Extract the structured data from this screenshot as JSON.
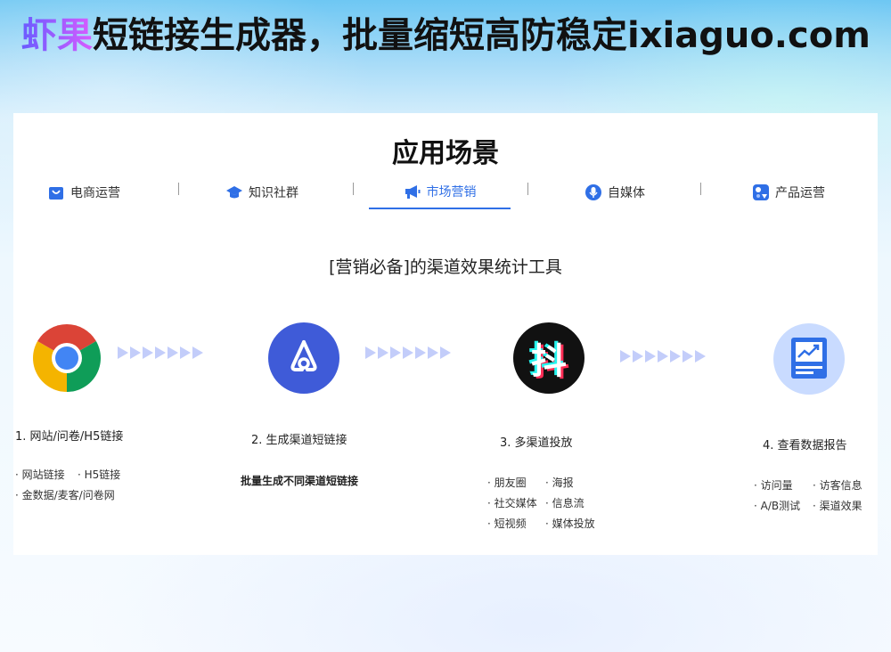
{
  "headline": {
    "brand": "虾果",
    "rest": "短链接生成器，批量缩短高防稳定ixiaguo.com"
  },
  "section": {
    "title": "应用场景"
  },
  "tabs": [
    {
      "label": "电商运营",
      "icon": "shopping-bag-icon"
    },
    {
      "label": "知识社群",
      "icon": "graduation-cap-icon"
    },
    {
      "label": "市场营销",
      "icon": "megaphone-icon",
      "active": true
    },
    {
      "label": "自媒体",
      "icon": "microphone-icon"
    },
    {
      "label": "产品运营",
      "icon": "product-cube-icon"
    }
  ],
  "subtitle": "[营销必备]的渠道效果统计工具",
  "steps": [
    {
      "label": "1. 网站/问卷/H5链接",
      "icon": "chrome-icon",
      "bullets": [
        [
          "· 网站链接",
          "· H5链接"
        ],
        [
          "· 金数据/麦客/问卷网"
        ]
      ]
    },
    {
      "label": "2. 生成渠道短链接",
      "icon": "shortlink-logo-icon",
      "note": "批量生成不同渠道短链接"
    },
    {
      "label": "3. 多渠道投放",
      "icon": "douyin-icon",
      "icon_text": "抖",
      "bullets": [
        [
          "· 朋友圈",
          "· 海报"
        ],
        [
          "· 社交媒体",
          "· 信息流"
        ],
        [
          "· 短视频",
          "· 媒体投放"
        ]
      ]
    },
    {
      "label": "4. 查看数据报告",
      "icon": "data-report-icon",
      "bullets": [
        [
          "· 访问量",
          "· 访客信息"
        ],
        [
          "· A/B测试",
          "· 渠道效果"
        ]
      ]
    }
  ],
  "colors": {
    "accent": "#2f6fe6",
    "arrow": "#c3cdfa",
    "step2": "#3f5bd8"
  }
}
